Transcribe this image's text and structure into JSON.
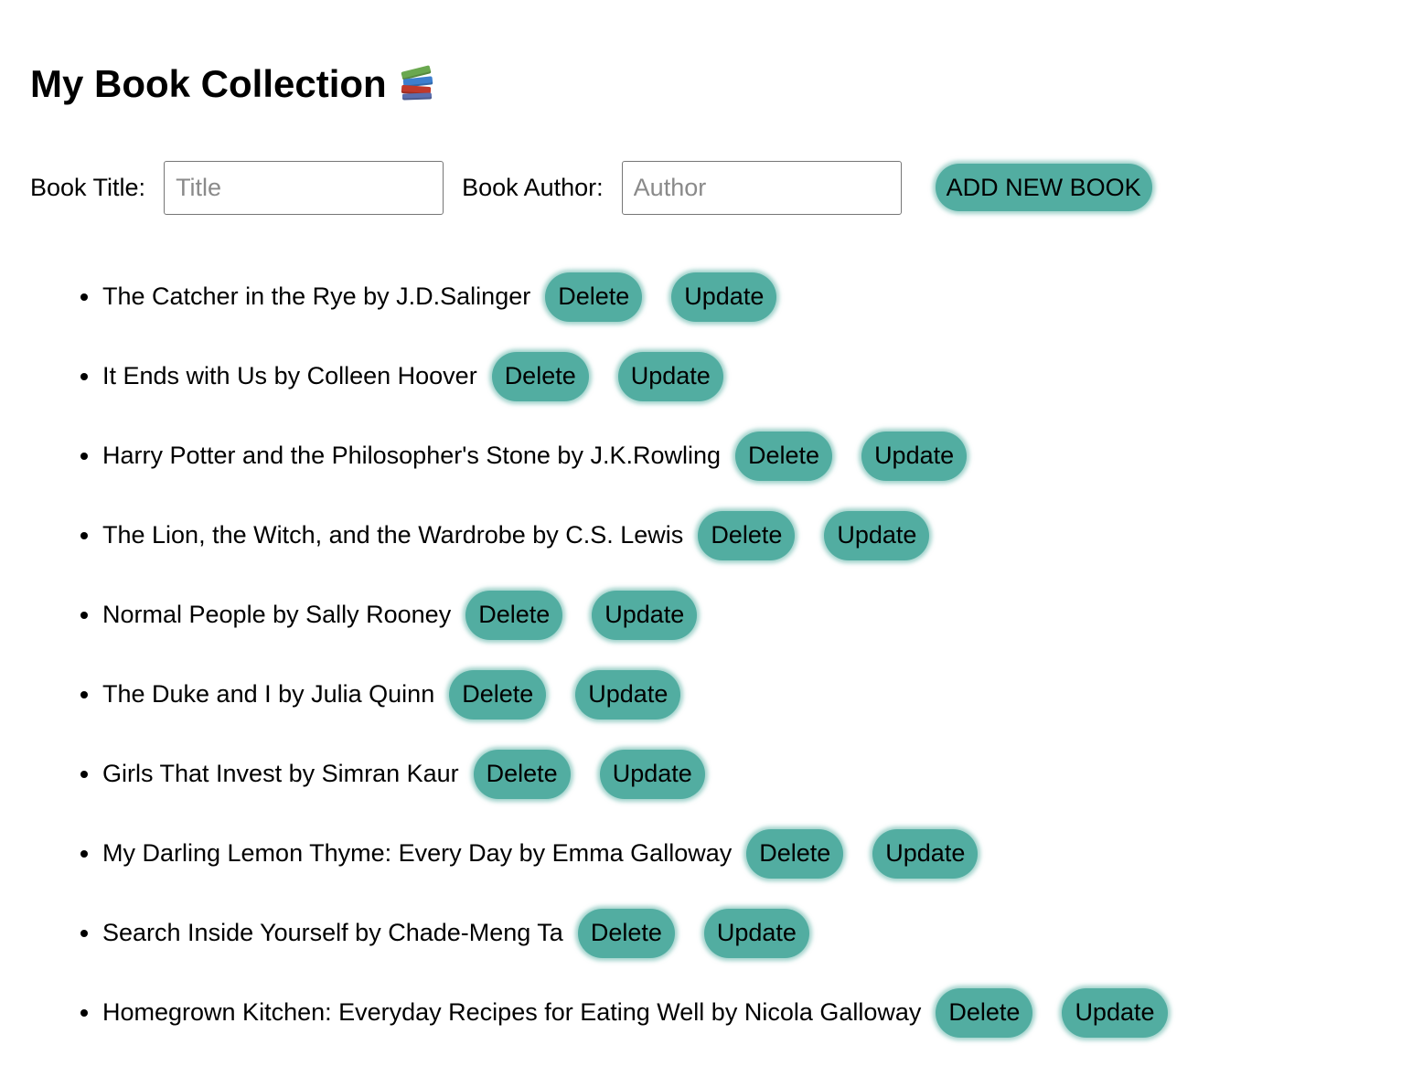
{
  "page": {
    "title": "My Book Collection"
  },
  "icons": {
    "title_icon": "books-stack-icon"
  },
  "form": {
    "title_label": "Book Title:",
    "title_placeholder": "Title",
    "title_value": "",
    "author_label": "Book Author:",
    "author_placeholder": "Author",
    "author_value": "",
    "add_button_label": "ADD NEW BOOK"
  },
  "buttons": {
    "delete_label": "Delete",
    "update_label": "Update"
  },
  "colors": {
    "button_background": "#52ada1",
    "text": "#000000"
  },
  "books": [
    {
      "text": "The Catcher in the Rye by J.D.Salinger"
    },
    {
      "text": "It Ends with Us by Colleen Hoover"
    },
    {
      "text": "Harry Potter and the Philosopher's Stone by J.K.Rowling"
    },
    {
      "text": "The Lion, the Witch, and the Wardrobe by C.S. Lewis"
    },
    {
      "text": "Normal People by Sally Rooney"
    },
    {
      "text": "The Duke and I by Julia Quinn"
    },
    {
      "text": "Girls That Invest by Simran Kaur"
    },
    {
      "text": "My Darling Lemon Thyme: Every Day by Emma Galloway"
    },
    {
      "text": "Search Inside Yourself by Chade-Meng Ta"
    },
    {
      "text": "Homegrown Kitchen: Everyday Recipes for Eating Well by Nicola Galloway"
    }
  ]
}
